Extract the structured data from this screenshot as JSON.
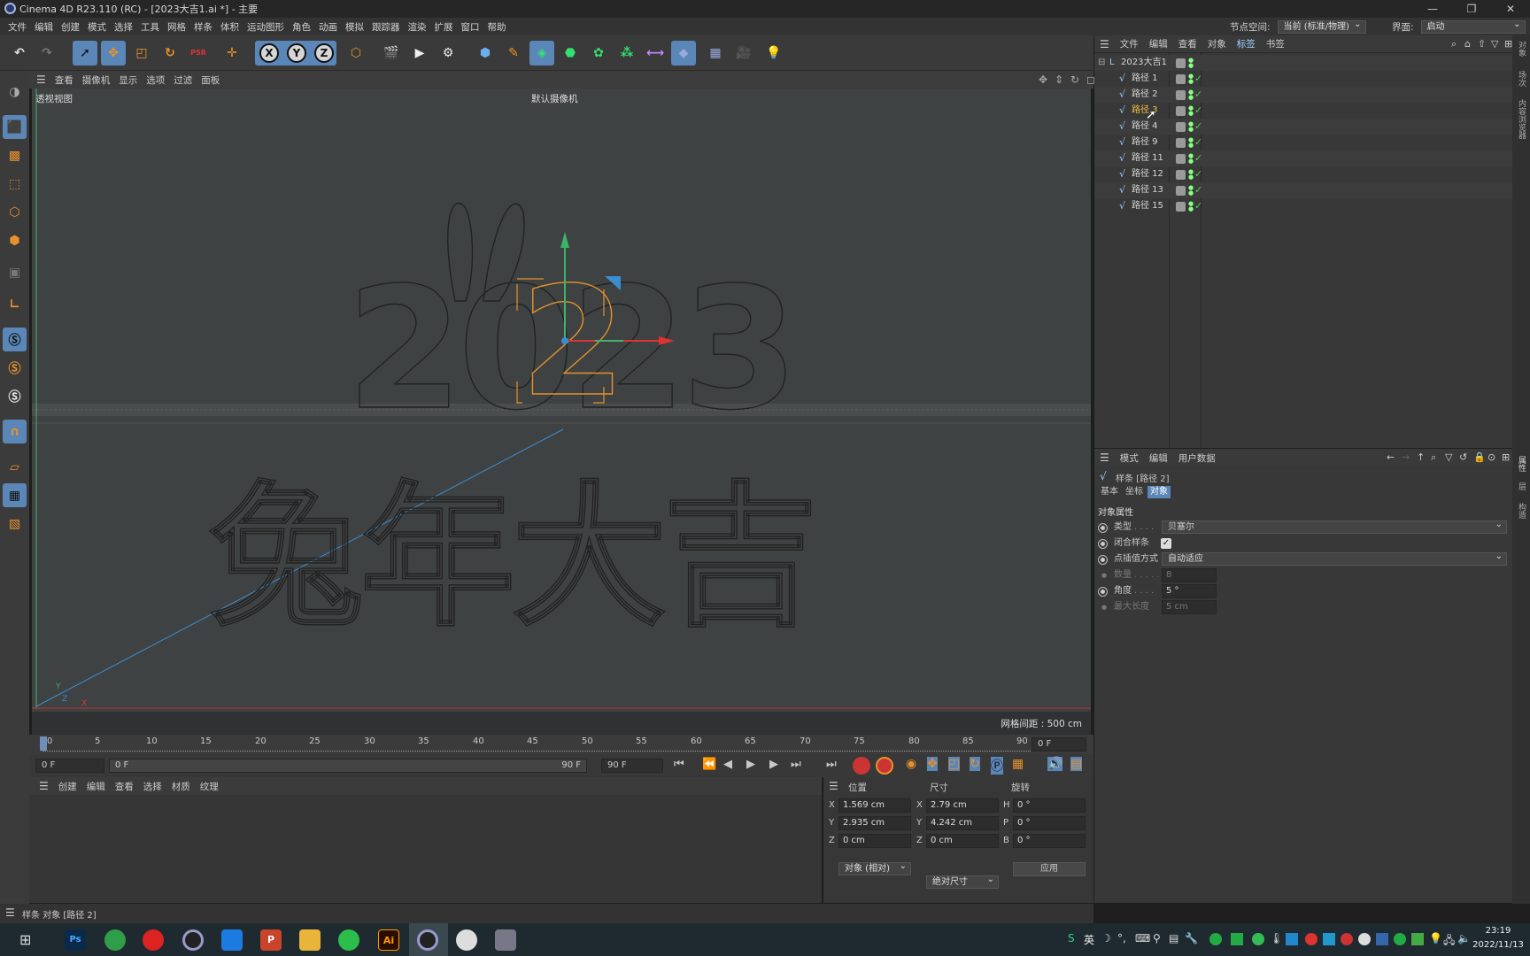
{
  "window": {
    "title": "Cinema 4D R23.110 (RC) - [2023大吉1.ai *] - 主要"
  },
  "menubar": {
    "items": [
      "文件",
      "编辑",
      "创建",
      "模式",
      "选择",
      "工具",
      "网格",
      "样条",
      "体积",
      "运动图形",
      "角色",
      "动画",
      "模拟",
      "跟踪器",
      "渲染",
      "扩展",
      "窗口",
      "帮助"
    ],
    "node_space_label": "节点空间:",
    "node_space_value": "当前 (标准/物理)",
    "interface_label": "界面:",
    "interface_value": "启动"
  },
  "toolbar": {
    "axis_x": "X",
    "axis_y": "Y",
    "axis_z": "Z",
    "psr": "PSR"
  },
  "viewport": {
    "menu": [
      "查看",
      "摄像机",
      "显示",
      "选项",
      "过滤",
      "面板"
    ],
    "view_name": "透视视图",
    "camera_name": "默认摄像机",
    "grid_spacing": "网格间距 : 500 cm",
    "year_text": "2023",
    "slogan_text": "兔年大吉",
    "axis_x": "X",
    "axis_y": "Y",
    "axis_z": "Z"
  },
  "timeline": {
    "ticks": [
      "0",
      "5",
      "10",
      "15",
      "20",
      "25",
      "30",
      "35",
      "40",
      "45",
      "50",
      "55",
      "60",
      "65",
      "70",
      "75",
      "80",
      "85",
      "90"
    ],
    "current_frame": "0 F",
    "start_frame": "0 F",
    "range_start": "0 F",
    "range_end": "90 F",
    "end_frame": "90 F"
  },
  "material_panel": {
    "menu": [
      "创建",
      "编辑",
      "查看",
      "选择",
      "材质",
      "纹理"
    ]
  },
  "coords": {
    "headers": {
      "position": "位置",
      "size": "尺寸",
      "rotation": "旋转"
    },
    "rows": [
      {
        "axis": "X",
        "pos": "1.569 cm",
        "saxis": "X",
        "size": "2.79 cm",
        "raxis": "H",
        "rot": "0 °"
      },
      {
        "axis": "Y",
        "pos": "2.935 cm",
        "saxis": "Y",
        "size": "4.242 cm",
        "raxis": "P",
        "rot": "0 °"
      },
      {
        "axis": "Z",
        "pos": "0 cm",
        "saxis": "Z",
        "size": "0 cm",
        "raxis": "B",
        "rot": "0 °"
      }
    ],
    "mode_select": "对象 (相对)",
    "size_select": "绝对尺寸",
    "apply_button": "应用"
  },
  "status": {
    "text": "样条 对象 [路径 2]"
  },
  "object_manager": {
    "menu": [
      "文件",
      "编辑",
      "查看",
      "对象",
      "标签",
      "书签"
    ],
    "root": "2023大吉1",
    "items": [
      "路径 1",
      "路径 2",
      "路径 3",
      "路径 4",
      "路径 9",
      "路径 11",
      "路径 12",
      "路径 13",
      "路径 15"
    ],
    "highlighted": "路径 3"
  },
  "attribute_manager": {
    "menu": [
      "模式",
      "编辑",
      "用户数据"
    ],
    "object_title": "样条 [路径 2]",
    "tabs": [
      "基本",
      "坐标",
      "对象"
    ],
    "active_tab": "对象",
    "section": "对象属性",
    "type_label": "类型",
    "type_value": "贝塞尔",
    "closed_label": "闭合样条",
    "interp_label": "点插值方式",
    "interp_value": "自动适应",
    "count_label": "数量",
    "count_value": "8",
    "angle_label": "角度",
    "angle_value": "5 °",
    "maxlen_label": "最大长度",
    "maxlen_value": "5 cm"
  },
  "right_strip": {
    "tabs": [
      "对象",
      "场次",
      "内容浏览器",
      "属性",
      "层",
      "构造"
    ]
  },
  "taskbar": {
    "time": "23:19",
    "date": "2022/11/13",
    "ime": "英",
    "apps": [
      "Ps",
      "Ai"
    ]
  },
  "colors": {
    "accent": "#5b86b8",
    "orange": "#e8922c",
    "highlight_text": "#f0c040"
  }
}
